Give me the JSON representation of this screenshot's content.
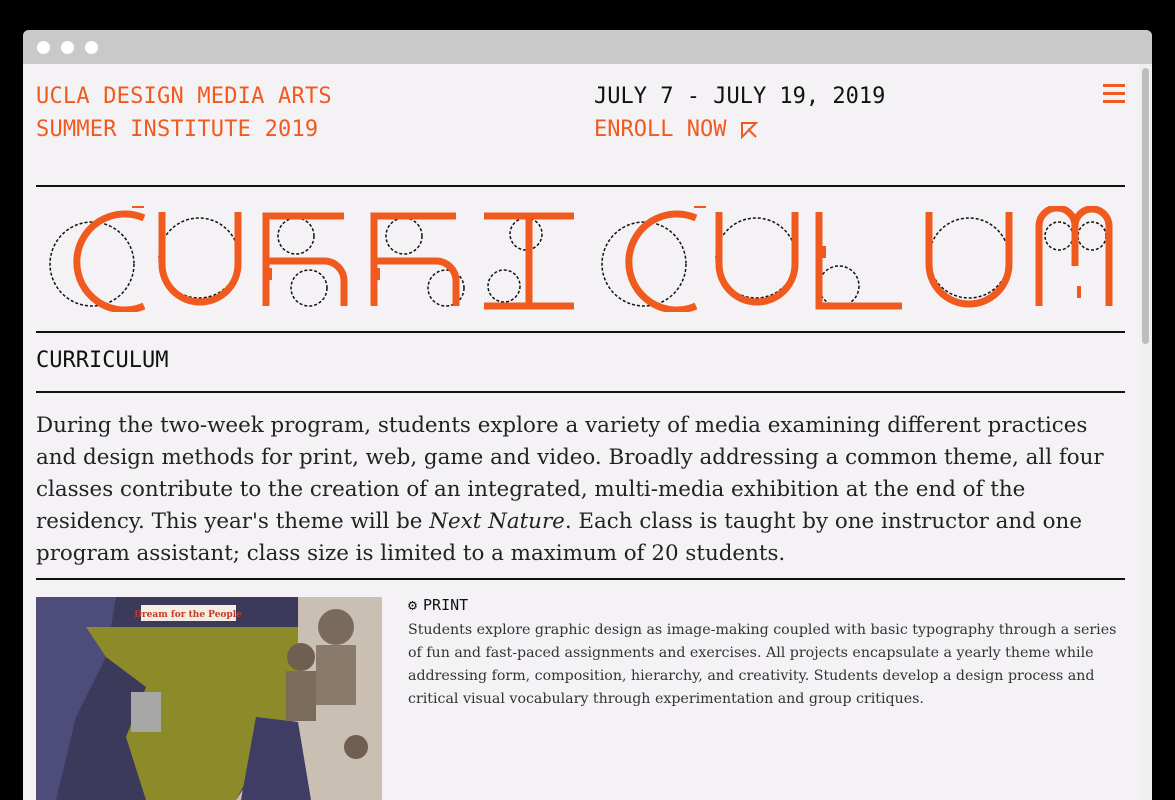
{
  "header": {
    "brand_line1": "UCLA DESIGN MEDIA ARTS",
    "brand_line2": "SUMMER INSTITUTE 2019",
    "dates": "JULY 7 - JULY 19, 2019",
    "enroll_label": "ENROLL NOW",
    "menu_icon": "hamburger-icon",
    "enroll_icon": "arrow-cursor-icon"
  },
  "banner": {
    "text": "CURRICULUM"
  },
  "section": {
    "title": "CURRICULUM"
  },
  "intro": {
    "part1": "During the two-week program, students explore a variety of media examining different practices and design methods for print, web, game and video. Broadly addressing a common theme, all four classes contribute to the creation of an integrated, multi-media exhibition at the end of the residency. This year's theme will be ",
    "theme": "Next Nature",
    "part2": ". Each class is taught by one instructor and one program assistant; class size is limited to a maximum of 20 students."
  },
  "course": {
    "name": "PRINT",
    "icon": "gear-icon",
    "image_caption": "Dream for the People",
    "description": "Students explore graphic design as image-making coupled with basic typography through a series of fun and fast-paced assignments and exercises. All projects encapsulate a yearly theme while addressing form, composition, hierarchy, and creativity. Students develop a design process and critical visual vocabulary through experimentation and group critiques."
  },
  "colors": {
    "accent": "#f05a1e",
    "background": "#f4f2f5",
    "text": "#111111"
  }
}
